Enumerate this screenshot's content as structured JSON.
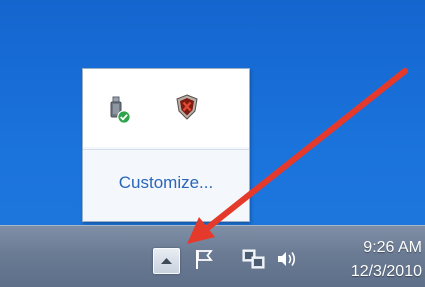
{
  "popup": {
    "link_label": "Customize...",
    "icons": [
      "usb-safely-remove-icon",
      "security-shield-icon"
    ]
  },
  "taskbar": {
    "show_hidden_icon": "chevron-up-icon",
    "tray_icons": [
      "action-center-flag-icon",
      "network-icon",
      "volume-icon"
    ],
    "clock": {
      "time": "9:26 AM",
      "date": "12/3/2010"
    }
  },
  "annotation": {
    "arrow_color": "#e53a2b"
  }
}
